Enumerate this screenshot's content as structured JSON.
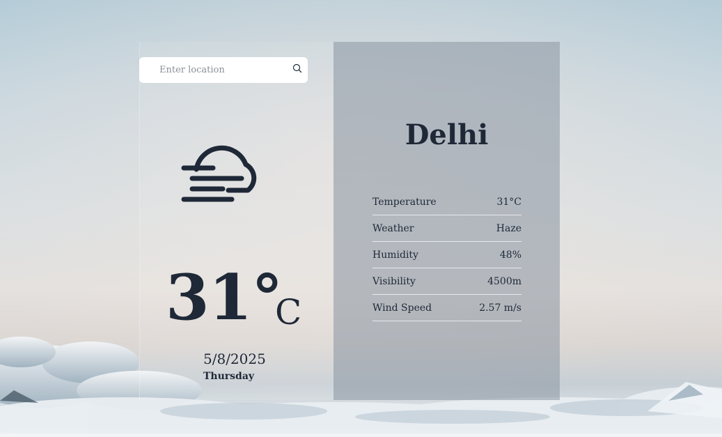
{
  "search": {
    "placeholder": "Enter location",
    "value": ""
  },
  "current": {
    "icon": "haze-cloud-icon",
    "temperature": "31°",
    "unit": "C",
    "date": "5/8/2025",
    "day": "Thursday"
  },
  "details": {
    "city": "Delhi",
    "rows": [
      {
        "label": "Temperature",
        "value": "31°C"
      },
      {
        "label": "Weather",
        "value": "Haze"
      },
      {
        "label": "Humidity",
        "value": "48%"
      },
      {
        "label": "Visibility",
        "value": "4500m"
      },
      {
        "label": "Wind Speed",
        "value": "2.57 m/s"
      }
    ]
  },
  "colors": {
    "text_dark": "#1e2837",
    "panel": "#8f9aa6",
    "search_bg": "#ffffff"
  }
}
